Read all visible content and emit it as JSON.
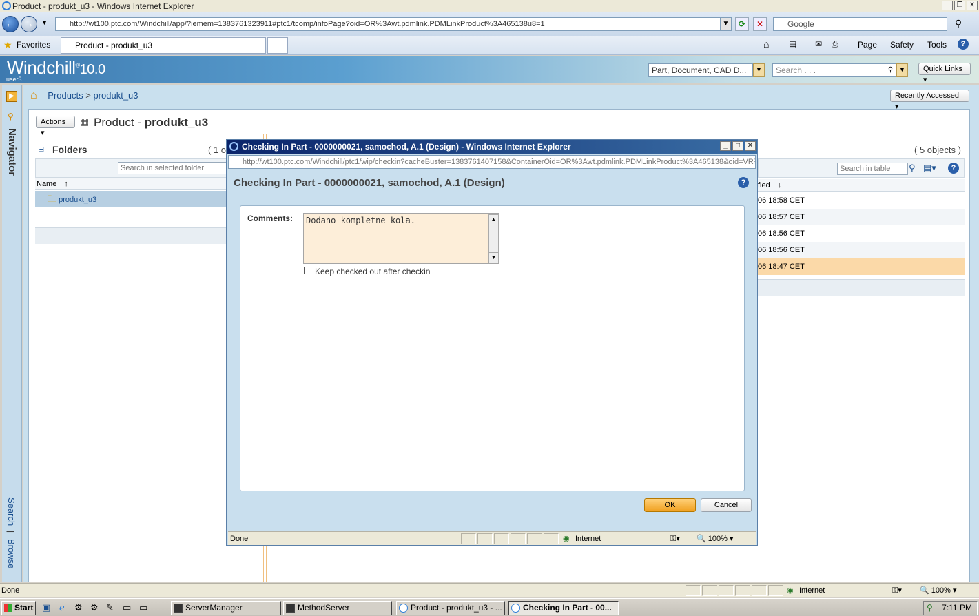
{
  "browser": {
    "window_title": "Product - produkt_u3 - Windows Internet Explorer",
    "address": "http://wt100.ptc.com/Windchill/app/?iemem=1383761323911#ptc1/tcomp/infoPage?oid=OR%3Awt.pdmlink.PDMLinkProduct%3A465138u8=1",
    "search_placeholder": "Google",
    "favorites_label": "Favorites",
    "tab_label": "Product - produkt_u3",
    "commands": [
      "Page",
      "Safety",
      "Tools"
    ]
  },
  "windchill": {
    "logo": "Windchill",
    "version": "10.0",
    "user": "user3",
    "search_type": "Part, Document, CAD D...",
    "search_placeholder": "Search . . .",
    "quick_links": "Quick Links",
    "recently_accessed": "Recently Accessed",
    "breadcrumb": {
      "root": "Products",
      "sep": ">",
      "current": "produkt_u3"
    },
    "actions_label": "Actions",
    "page_title_prefix": "Product - ",
    "page_title_name": "produkt_u3",
    "navigator_label": "Navigator",
    "search_link": "Search",
    "browse_link": "Browse",
    "sep_pipe": "|"
  },
  "folders": {
    "title": "Folders",
    "count_partial": "( 1 o",
    "search_placeholder": "Search in selected folder",
    "column_name": "Name",
    "sort_icon": "↑",
    "items": [
      "produkt_u3"
    ]
  },
  "table": {
    "count": "( 5 objects )",
    "search_placeholder": "Search in table",
    "column_modified": "fied",
    "sort_icon": "↓",
    "modified": [
      "06 18:58 CET",
      "06 18:57 CET",
      "06 18:56 CET",
      "06 18:56 CET",
      "06 18:47 CET"
    ],
    "highlight_color": "#fbd9a8"
  },
  "dialog": {
    "window_title": "Checking In Part - 0000000021, samochod, A.1 (Design) - Windows Internet Explorer",
    "address": "http://wt100.ptc.com/Windchill/ptc1/wip/checkin?cacheBuster=1383761407158&ContainerOid=OR%3Awt.pdmlink.PDMLinkProduct%3A465138&oid=VR%",
    "heading": "Checking In Part - 0000000021, samochod, A.1 (Design)",
    "comments_label": "Comments:",
    "comments_value": "Dodano kompletne kola.",
    "keep_checked_out": "Keep checked out after checkin",
    "ok": "OK",
    "cancel": "Cancel",
    "status_done": "Done",
    "zone": "Internet",
    "zoom": "100%"
  },
  "statusbar": {
    "done": "Done",
    "zone": "Internet",
    "zoom": "100%"
  },
  "taskbar": {
    "start": "Start",
    "buttons": [
      "ServerManager",
      "MethodServer",
      "Product - produkt_u3 - ...",
      "Checking In Part - 00..."
    ],
    "clock": "7:11 PM"
  }
}
